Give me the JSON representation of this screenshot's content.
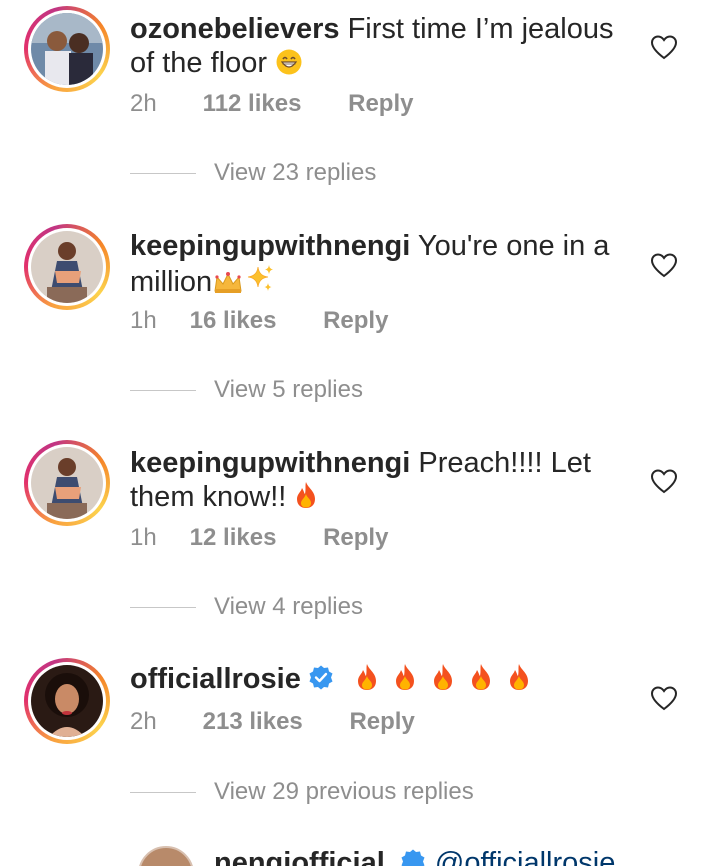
{
  "comments": [
    {
      "username": "ozonebelievers",
      "text": "First time I’m jealous of the floor",
      "emoji": "grinning-face",
      "time": "2h",
      "likes": "112 likes",
      "reply": "Reply",
      "view_replies": "View 23 replies",
      "verified": false
    },
    {
      "username": "keepingupwithnengi",
      "text": "You're one in a million",
      "emoji": "crown-sparkles",
      "time": "1h",
      "likes": "16 likes",
      "reply": "Reply",
      "view_replies": "View 5 replies",
      "verified": false
    },
    {
      "username": "keepingupwithnengi",
      "text": "Preach!!!! Let them know!!",
      "emoji": "fire",
      "time": "1h",
      "likes": "12 likes",
      "reply": "Reply",
      "view_replies": "View 4 replies",
      "verified": false
    },
    {
      "username": "officiallrosie",
      "text": "",
      "emoji": "fire x5",
      "time": "2h",
      "likes": "213 likes",
      "reply": "Reply",
      "view_replies": "View 29 previous replies",
      "verified": true
    }
  ],
  "partial_reply": {
    "username": "nengiofficial",
    "mention": "@officiallrosie"
  },
  "colors": {
    "text": "#262626",
    "muted": "#8e8e8e",
    "verified_blue": "#3897f0",
    "mention": "#00376b"
  }
}
